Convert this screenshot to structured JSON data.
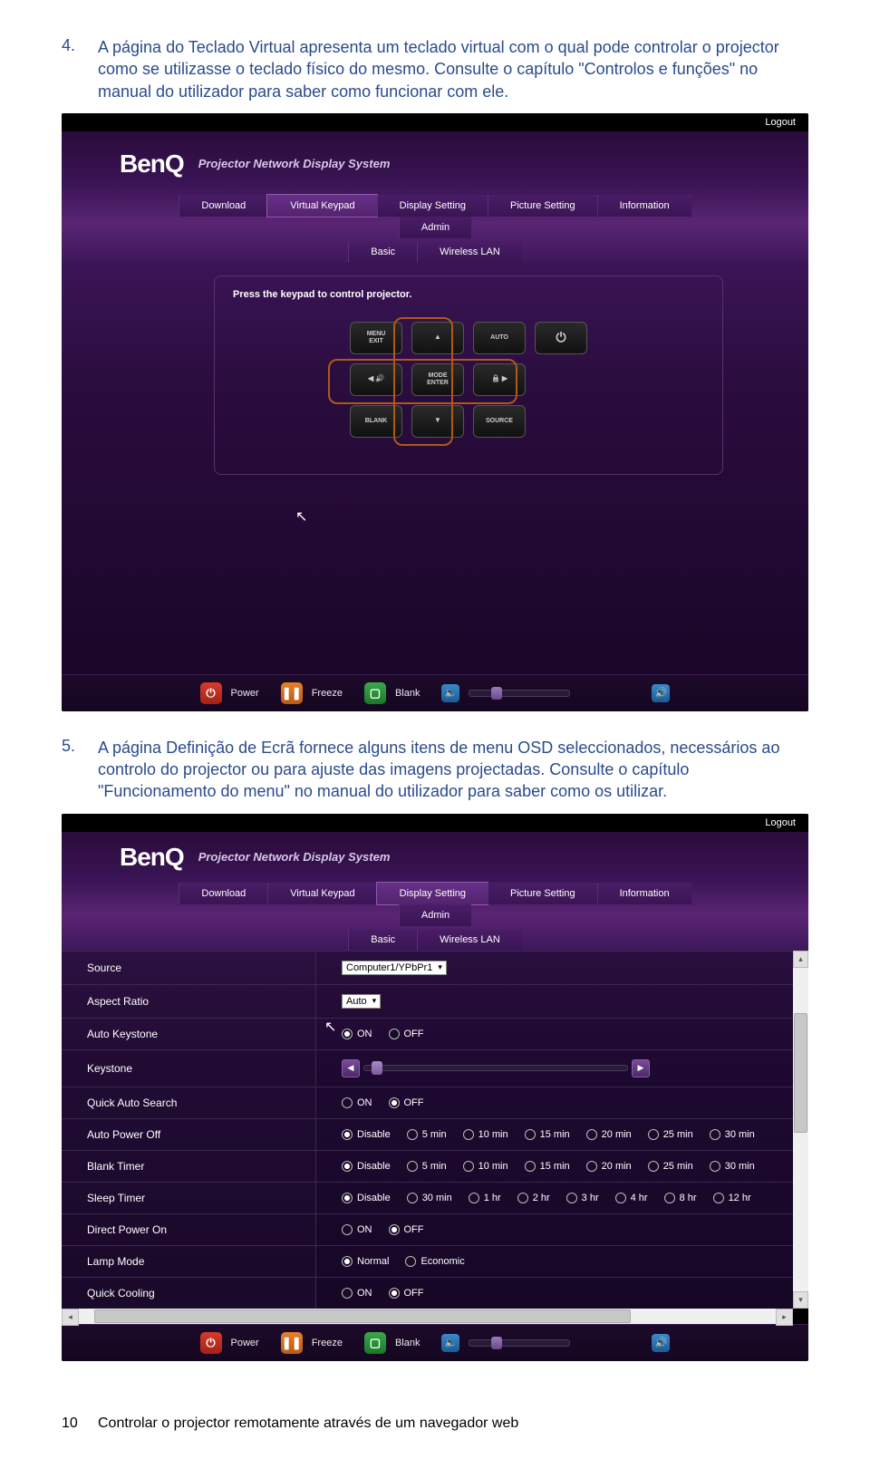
{
  "item4": {
    "num": "4.",
    "text_a": "A página do Teclado Virtual apresenta um teclado virtual com o qual pode controlar o projector como se utilizasse o teclado físico do mesmo. Consulte o capítulo ",
    "link": "\"Controlos e funções\"",
    "text_b": " no manual do utilizador para saber como funcionar com ele."
  },
  "item5": {
    "num": "5.",
    "text_a": "A página Definição de Ecrã fornece alguns itens de menu OSD seleccionados, necessários ao controlo do projector ou para ajuste das imagens projectadas. Consulte o capítulo ",
    "link": "\"Funcionamento do menu\"",
    "text_b": " no manual do utilizador para saber como os utilizar."
  },
  "ss": {
    "logout": "Logout",
    "logo": "BenQ",
    "subtitle": "Projector Network Display System",
    "nav": [
      "Download",
      "Virtual Keypad",
      "Display Setting",
      "Picture Setting",
      "Information",
      "Admin"
    ],
    "nav2": [
      "Basic",
      "Wireless LAN"
    ]
  },
  "ss1": {
    "instr": "Press the keypad to control projector.",
    "keys": {
      "menu": "MENU\nEXIT",
      "auto": "AUTO",
      "mode": "MODE\nENTER",
      "blank": "BLANK",
      "source": "SOURCE"
    }
  },
  "status": {
    "power": "Power",
    "freeze": "Freeze",
    "blank": "Blank"
  },
  "ss2": {
    "rows": {
      "source": {
        "label": "Source",
        "value": "Computer1/YPbPr1"
      },
      "aspect": {
        "label": "Aspect Ratio",
        "value": "Auto"
      },
      "autokey": {
        "label": "Auto Keystone",
        "opts": [
          "ON",
          "OFF"
        ],
        "sel": 0
      },
      "keystone": {
        "label": "Keystone"
      },
      "quicksearch": {
        "label": "Quick Auto Search",
        "opts": [
          "ON",
          "OFF"
        ],
        "sel": 1
      },
      "autopoff": {
        "label": "Auto Power Off",
        "opts": [
          "Disable",
          "5 min",
          "10 min",
          "15 min",
          "20 min",
          "25 min",
          "30 min"
        ],
        "sel": 0
      },
      "blanktimer": {
        "label": "Blank Timer",
        "opts": [
          "Disable",
          "5 min",
          "10 min",
          "15 min",
          "20 min",
          "25 min",
          "30 min"
        ],
        "sel": 0
      },
      "sleeptimer": {
        "label": "Sleep Timer",
        "opts": [
          "Disable",
          "30 min",
          "1 hr",
          "2 hr",
          "3 hr",
          "4 hr",
          "8 hr",
          "12 hr"
        ],
        "sel": 0
      },
      "directpon": {
        "label": "Direct Power On",
        "opts": [
          "ON",
          "OFF"
        ],
        "sel": 1
      },
      "lampmode": {
        "label": "Lamp Mode",
        "opts": [
          "Normal",
          "Economic"
        ],
        "sel": 0
      },
      "quickcool": {
        "label": "Quick Cooling",
        "opts": [
          "ON",
          "OFF"
        ],
        "sel": 1
      }
    }
  },
  "footer": {
    "page": "10",
    "title": "Controlar o projector remotamente através de um navegador web"
  }
}
